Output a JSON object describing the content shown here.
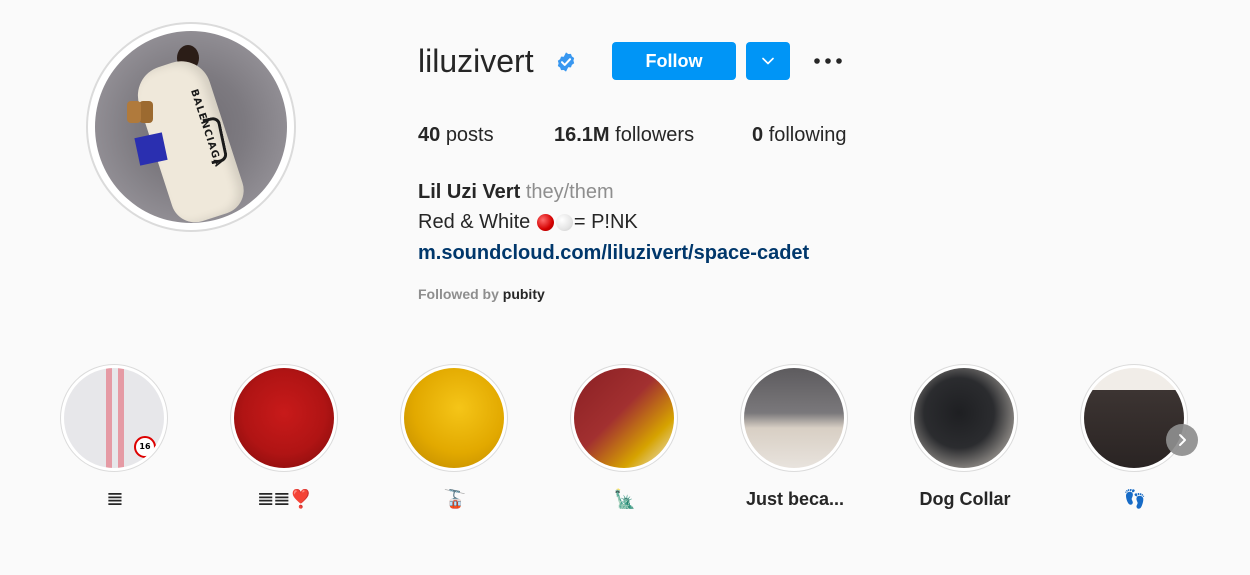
{
  "profile": {
    "username": "liluzivert",
    "verified": true,
    "follow_label": "Follow",
    "posts_count": "40",
    "posts_label": "posts",
    "followers_count": "16.1M",
    "followers_label": "followers",
    "following_count": "0",
    "following_label": "following",
    "full_name": "Lil Uzi Vert",
    "pronouns": "they/them",
    "bio_prefix": "Red & White ",
    "bio_suffix": "= P!NK",
    "link": "m.soundcloud.com/liluzivert/space-cadet",
    "followed_by_label": "Followed by",
    "followed_by_user": "pubity",
    "avatar_text": "BALENCIAGA"
  },
  "highlights": [
    {
      "label": "𝌆"
    },
    {
      "label": "𝌆𝌆❣️"
    },
    {
      "label": "🚡"
    },
    {
      "label": "🗽"
    },
    {
      "label": "Just beca..."
    },
    {
      "label": "Dog Collar"
    },
    {
      "label": "👣"
    }
  ],
  "highlight_badges": {
    "speed_sign": "16"
  },
  "colors": {
    "accent": "#0095f6",
    "link": "#00376b",
    "text": "#262626",
    "muted": "#8e8e8e",
    "background": "#fafafa"
  },
  "icons": {
    "verified": "verified-badge-icon",
    "dropdown": "chevron-down-icon",
    "more": "more-options-icon",
    "next": "chevron-right-icon"
  }
}
